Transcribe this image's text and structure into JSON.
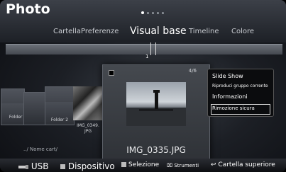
{
  "header": {
    "title": "Photo",
    "menu": [
      "Cartella",
      "Preferenze",
      "Visual base",
      "Timeline",
      "Colore"
    ],
    "active_index": 2
  },
  "timeline": {
    "position_label": "1",
    "marker_value": 1
  },
  "thumbnails": [
    {
      "label": "Folder 1"
    },
    {
      "label": "Folder 2"
    },
    {
      "label": "IMG_0349.\nJPG"
    }
  ],
  "focused": {
    "count": "4/6",
    "filename": "IMG_0335.JPG"
  },
  "popup": {
    "items": [
      "Slide Show",
      "Riproduci gruppo corrente",
      "Informazioni",
      "Rimozione sicura"
    ],
    "selected_index": 3
  },
  "path": "../ Nome cart/",
  "footer": {
    "usb": "USB",
    "device": "Dispositivo",
    "select": "Selezione",
    "tools": "Strumenti",
    "parent": "Cartella superiore"
  },
  "colors": {
    "background": "#1c1f25",
    "popup_border": "#d8d8d8"
  },
  "icons": [
    "usb-icon",
    "stop-square-icon",
    "tools-icon",
    "return-icon"
  ]
}
